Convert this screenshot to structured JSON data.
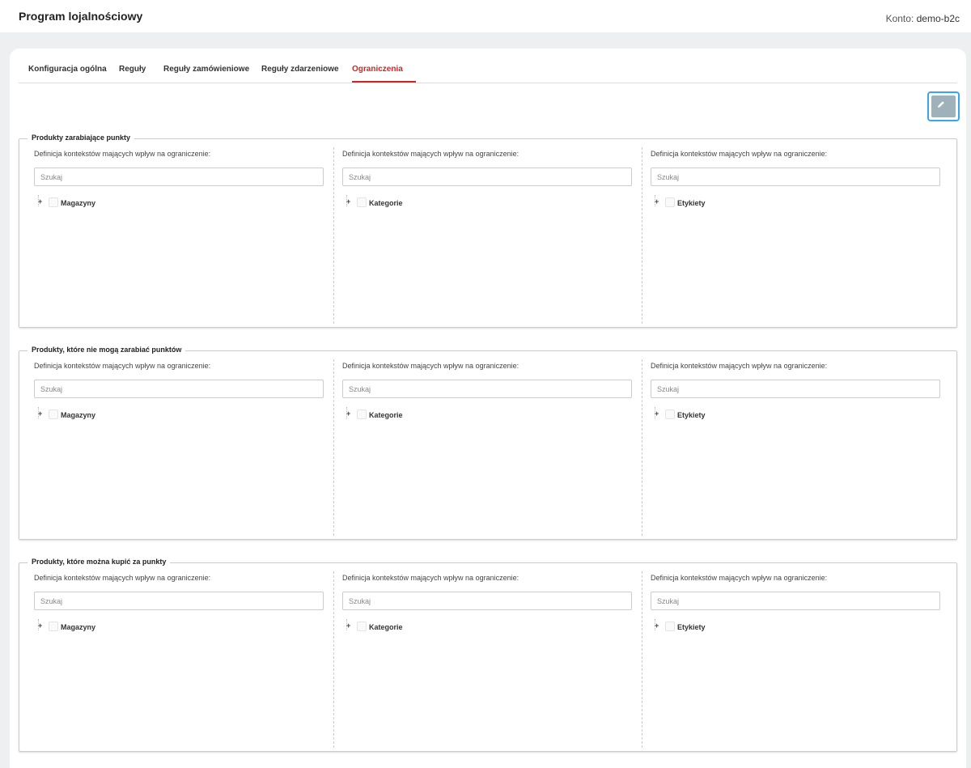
{
  "header": {
    "title": "Program lojalnościowy",
    "account_label": "Konto:",
    "account_value": "demo-b2c"
  },
  "tabs": [
    {
      "label": "Konfiguracja ogólna",
      "active": false
    },
    {
      "label": "Reguły",
      "active": false
    },
    {
      "label": "Reguły zamówieniowe",
      "active": false
    },
    {
      "label": "Reguły zdarzeniowe",
      "active": false
    },
    {
      "label": "Ograniczenia",
      "active": true
    }
  ],
  "edit_button": {
    "icon": "pencil-icon"
  },
  "sections": [
    {
      "legend": "Produkty zarabiające punkty",
      "columns": [
        {
          "label": "Definicja kontekstów mających wpływ na ograniczenie:",
          "placeholder": "Szukaj",
          "node": "Magazyny"
        },
        {
          "label": "Definicja kontekstów mających wpływ na ograniczenie:",
          "placeholder": "Szukaj",
          "node": "Kategorie"
        },
        {
          "label": "Definicja kontekstów mających wpływ na ograniczenie:",
          "placeholder": "Szukaj",
          "node": "Etykiety"
        }
      ]
    },
    {
      "legend": "Produkty, które nie mogą zarabiać punktów",
      "columns": [
        {
          "label": "Definicja kontekstów mających wpływ na ograniczenie:",
          "placeholder": "Szukaj",
          "node": "Magazyny"
        },
        {
          "label": "Definicja kontekstów mających wpływ na ograniczenie:",
          "placeholder": "Szukaj",
          "node": "Kategorie"
        },
        {
          "label": "Definicja kontekstów mających wpływ na ograniczenie:",
          "placeholder": "Szukaj",
          "node": "Etykiety"
        }
      ]
    },
    {
      "legend": "Produkty, które można kupić za punkty",
      "columns": [
        {
          "label": "Definicja kontekstów mających wpływ na ograniczenie:",
          "placeholder": "Szukaj",
          "node": "Magazyny"
        },
        {
          "label": "Definicja kontekstów mających wpływ na ograniczenie:",
          "placeholder": "Szukaj",
          "node": "Kategorie"
        },
        {
          "label": "Definicja kontekstów mających wpływ na ograniczenie:",
          "placeholder": "Szukaj",
          "node": "Etykiety"
        }
      ]
    }
  ],
  "colors": {
    "accent": "#c62828",
    "focus": "#3aa6e8",
    "button": "#9fb2bb"
  }
}
